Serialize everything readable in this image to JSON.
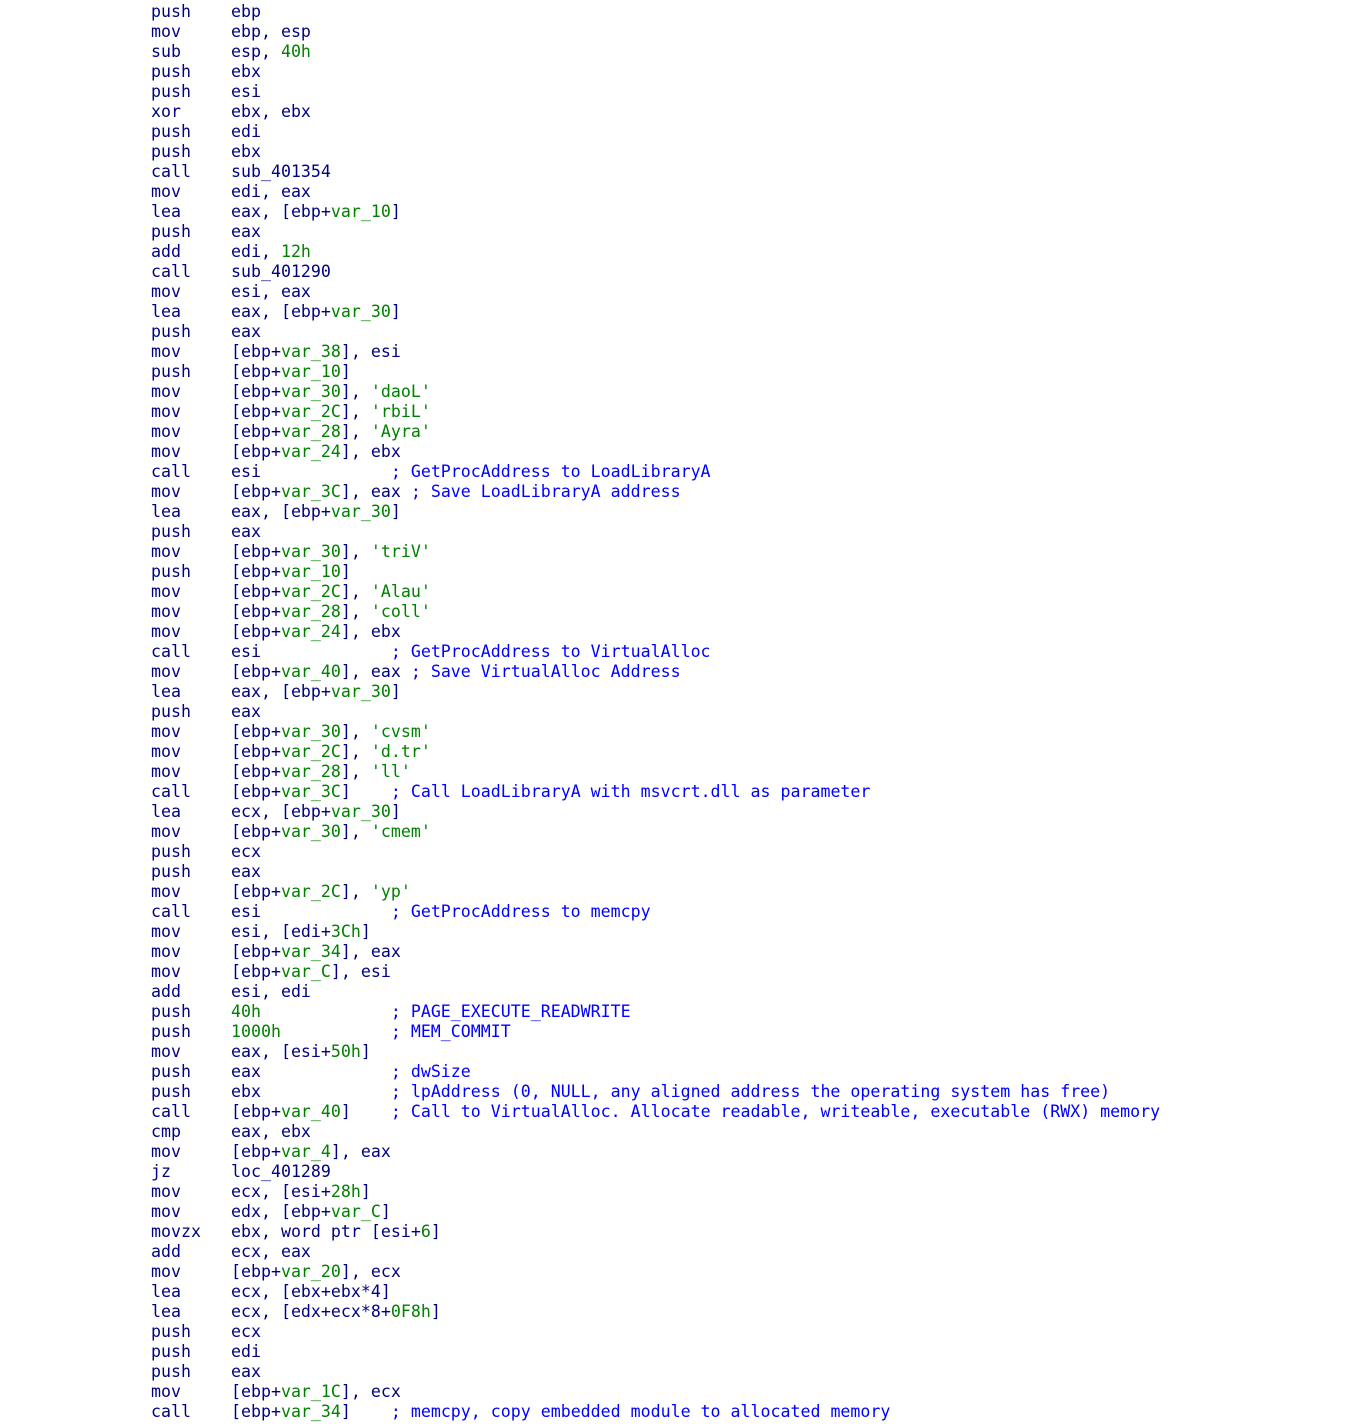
{
  "colors": {
    "background": "#ffffff",
    "instruction": "#000080",
    "variable": "#008000",
    "immediate": "#008000",
    "string": "#008000",
    "comment": "#0000ff"
  },
  "lines": [
    {
      "mnem": "push",
      "ops": [
        [
          "n",
          "ebp"
        ]
      ],
      "pad": "",
      "comment": ""
    },
    {
      "mnem": "mov",
      "ops": [
        [
          "n",
          "ebp, esp"
        ]
      ],
      "pad": "",
      "comment": ""
    },
    {
      "mnem": "sub",
      "ops": [
        [
          "n",
          "esp, "
        ],
        [
          "h",
          "40h"
        ]
      ],
      "pad": "",
      "comment": ""
    },
    {
      "mnem": "push",
      "ops": [
        [
          "n",
          "ebx"
        ]
      ],
      "pad": "",
      "comment": ""
    },
    {
      "mnem": "push",
      "ops": [
        [
          "n",
          "esi"
        ]
      ],
      "pad": "",
      "comment": ""
    },
    {
      "mnem": "xor",
      "ops": [
        [
          "n",
          "ebx, ebx"
        ]
      ],
      "pad": "",
      "comment": ""
    },
    {
      "mnem": "push",
      "ops": [
        [
          "n",
          "edi"
        ]
      ],
      "pad": "",
      "comment": ""
    },
    {
      "mnem": "push",
      "ops": [
        [
          "n",
          "ebx"
        ]
      ],
      "pad": "",
      "comment": ""
    },
    {
      "mnem": "call",
      "ops": [
        [
          "n",
          "sub_401354"
        ]
      ],
      "pad": "",
      "comment": ""
    },
    {
      "mnem": "mov",
      "ops": [
        [
          "n",
          "edi, eax"
        ]
      ],
      "pad": "",
      "comment": ""
    },
    {
      "mnem": "lea",
      "ops": [
        [
          "n",
          "eax, [ebp+"
        ],
        [
          "v",
          "var_10"
        ],
        [
          "n",
          "]"
        ]
      ],
      "pad": "",
      "comment": ""
    },
    {
      "mnem": "push",
      "ops": [
        [
          "n",
          "eax"
        ]
      ],
      "pad": "",
      "comment": ""
    },
    {
      "mnem": "add",
      "ops": [
        [
          "n",
          "edi, "
        ],
        [
          "h",
          "12h"
        ]
      ],
      "pad": "",
      "comment": ""
    },
    {
      "mnem": "call",
      "ops": [
        [
          "n",
          "sub_401290"
        ]
      ],
      "pad": "",
      "comment": ""
    },
    {
      "mnem": "mov",
      "ops": [
        [
          "n",
          "esi, eax"
        ]
      ],
      "pad": "",
      "comment": ""
    },
    {
      "mnem": "lea",
      "ops": [
        [
          "n",
          "eax, [ebp+"
        ],
        [
          "v",
          "var_30"
        ],
        [
          "n",
          "]"
        ]
      ],
      "pad": "",
      "comment": ""
    },
    {
      "mnem": "push",
      "ops": [
        [
          "n",
          "eax"
        ]
      ],
      "pad": "",
      "comment": ""
    },
    {
      "mnem": "mov",
      "ops": [
        [
          "n",
          "[ebp+"
        ],
        [
          "v",
          "var_38"
        ],
        [
          "n",
          "], esi"
        ]
      ],
      "pad": "",
      "comment": ""
    },
    {
      "mnem": "push",
      "ops": [
        [
          "n",
          "[ebp+"
        ],
        [
          "v",
          "var_10"
        ],
        [
          "n",
          "]"
        ]
      ],
      "pad": "",
      "comment": ""
    },
    {
      "mnem": "mov",
      "ops": [
        [
          "n",
          "[ebp+"
        ],
        [
          "v",
          "var_30"
        ],
        [
          "n",
          "], "
        ],
        [
          "s",
          "'daoL'"
        ]
      ],
      "pad": "",
      "comment": ""
    },
    {
      "mnem": "mov",
      "ops": [
        [
          "n",
          "[ebp+"
        ],
        [
          "v",
          "var_2C"
        ],
        [
          "n",
          "], "
        ],
        [
          "s",
          "'rbiL'"
        ]
      ],
      "pad": "",
      "comment": ""
    },
    {
      "mnem": "mov",
      "ops": [
        [
          "n",
          "[ebp+"
        ],
        [
          "v",
          "var_28"
        ],
        [
          "n",
          "], "
        ],
        [
          "s",
          "'Ayra'"
        ]
      ],
      "pad": "",
      "comment": ""
    },
    {
      "mnem": "mov",
      "ops": [
        [
          "n",
          "[ebp+"
        ],
        [
          "v",
          "var_24"
        ],
        [
          "n",
          "], ebx"
        ]
      ],
      "pad": "",
      "comment": ""
    },
    {
      "mnem": "call",
      "ops": [
        [
          "n",
          "esi"
        ]
      ],
      "pad": "             ",
      "comment": "; GetProcAddress to LoadLibraryA"
    },
    {
      "mnem": "mov",
      "ops": [
        [
          "n",
          "[ebp+"
        ],
        [
          "v",
          "var_3C"
        ],
        [
          "n",
          "], eax"
        ]
      ],
      "pad": " ",
      "comment": "; Save LoadLibraryA address"
    },
    {
      "mnem": "lea",
      "ops": [
        [
          "n",
          "eax, [ebp+"
        ],
        [
          "v",
          "var_30"
        ],
        [
          "n",
          "]"
        ]
      ],
      "pad": "",
      "comment": ""
    },
    {
      "mnem": "push",
      "ops": [
        [
          "n",
          "eax"
        ]
      ],
      "pad": "",
      "comment": ""
    },
    {
      "mnem": "mov",
      "ops": [
        [
          "n",
          "[ebp+"
        ],
        [
          "v",
          "var_30"
        ],
        [
          "n",
          "], "
        ],
        [
          "s",
          "'triV'"
        ]
      ],
      "pad": "",
      "comment": ""
    },
    {
      "mnem": "push",
      "ops": [
        [
          "n",
          "[ebp+"
        ],
        [
          "v",
          "var_10"
        ],
        [
          "n",
          "]"
        ]
      ],
      "pad": "",
      "comment": ""
    },
    {
      "mnem": "mov",
      "ops": [
        [
          "n",
          "[ebp+"
        ],
        [
          "v",
          "var_2C"
        ],
        [
          "n",
          "], "
        ],
        [
          "s",
          "'Alau'"
        ]
      ],
      "pad": "",
      "comment": ""
    },
    {
      "mnem": "mov",
      "ops": [
        [
          "n",
          "[ebp+"
        ],
        [
          "v",
          "var_28"
        ],
        [
          "n",
          "], "
        ],
        [
          "s",
          "'coll'"
        ]
      ],
      "pad": "",
      "comment": ""
    },
    {
      "mnem": "mov",
      "ops": [
        [
          "n",
          "[ebp+"
        ],
        [
          "v",
          "var_24"
        ],
        [
          "n",
          "], ebx"
        ]
      ],
      "pad": "",
      "comment": ""
    },
    {
      "mnem": "call",
      "ops": [
        [
          "n",
          "esi"
        ]
      ],
      "pad": "             ",
      "comment": "; GetProcAddress to VirtualAlloc"
    },
    {
      "mnem": "mov",
      "ops": [
        [
          "n",
          "[ebp+"
        ],
        [
          "v",
          "var_40"
        ],
        [
          "n",
          "], eax"
        ]
      ],
      "pad": " ",
      "comment": "; Save VirtualAlloc Address"
    },
    {
      "mnem": "lea",
      "ops": [
        [
          "n",
          "eax, [ebp+"
        ],
        [
          "v",
          "var_30"
        ],
        [
          "n",
          "]"
        ]
      ],
      "pad": "",
      "comment": ""
    },
    {
      "mnem": "push",
      "ops": [
        [
          "n",
          "eax"
        ]
      ],
      "pad": "",
      "comment": ""
    },
    {
      "mnem": "mov",
      "ops": [
        [
          "n",
          "[ebp+"
        ],
        [
          "v",
          "var_30"
        ],
        [
          "n",
          "], "
        ],
        [
          "s",
          "'cvsm'"
        ]
      ],
      "pad": "",
      "comment": ""
    },
    {
      "mnem": "mov",
      "ops": [
        [
          "n",
          "[ebp+"
        ],
        [
          "v",
          "var_2C"
        ],
        [
          "n",
          "], "
        ],
        [
          "s",
          "'d.tr'"
        ]
      ],
      "pad": "",
      "comment": ""
    },
    {
      "mnem": "mov",
      "ops": [
        [
          "n",
          "[ebp+"
        ],
        [
          "v",
          "var_28"
        ],
        [
          "n",
          "], "
        ],
        [
          "s",
          "'ll'"
        ]
      ],
      "pad": "",
      "comment": ""
    },
    {
      "mnem": "call",
      "ops": [
        [
          "n",
          "[ebp+"
        ],
        [
          "v",
          "var_3C"
        ],
        [
          "n",
          "]"
        ]
      ],
      "pad": "    ",
      "comment": "; Call LoadLibraryA with msvcrt.dll as parameter"
    },
    {
      "mnem": "lea",
      "ops": [
        [
          "n",
          "ecx, [ebp+"
        ],
        [
          "v",
          "var_30"
        ],
        [
          "n",
          "]"
        ]
      ],
      "pad": "",
      "comment": ""
    },
    {
      "mnem": "mov",
      "ops": [
        [
          "n",
          "[ebp+"
        ],
        [
          "v",
          "var_30"
        ],
        [
          "n",
          "], "
        ],
        [
          "s",
          "'cmem'"
        ]
      ],
      "pad": "",
      "comment": ""
    },
    {
      "mnem": "push",
      "ops": [
        [
          "n",
          "ecx"
        ]
      ],
      "pad": "",
      "comment": ""
    },
    {
      "mnem": "push",
      "ops": [
        [
          "n",
          "eax"
        ]
      ],
      "pad": "",
      "comment": ""
    },
    {
      "mnem": "mov",
      "ops": [
        [
          "n",
          "[ebp+"
        ],
        [
          "v",
          "var_2C"
        ],
        [
          "n",
          "], "
        ],
        [
          "s",
          "'yp'"
        ]
      ],
      "pad": "",
      "comment": ""
    },
    {
      "mnem": "call",
      "ops": [
        [
          "n",
          "esi"
        ]
      ],
      "pad": "             ",
      "comment": "; GetProcAddress to memcpy"
    },
    {
      "mnem": "mov",
      "ops": [
        [
          "n",
          "esi, [edi+"
        ],
        [
          "h",
          "3Ch"
        ],
        [
          "n",
          "]"
        ]
      ],
      "pad": "",
      "comment": ""
    },
    {
      "mnem": "mov",
      "ops": [
        [
          "n",
          "[ebp+"
        ],
        [
          "v",
          "var_34"
        ],
        [
          "n",
          "], eax"
        ]
      ],
      "pad": "",
      "comment": ""
    },
    {
      "mnem": "mov",
      "ops": [
        [
          "n",
          "[ebp+"
        ],
        [
          "v",
          "var_C"
        ],
        [
          "n",
          "], esi"
        ]
      ],
      "pad": "",
      "comment": ""
    },
    {
      "mnem": "add",
      "ops": [
        [
          "n",
          "esi, edi"
        ]
      ],
      "pad": "",
      "comment": ""
    },
    {
      "mnem": "push",
      "ops": [
        [
          "h",
          "40h"
        ]
      ],
      "pad": "             ",
      "comment": "; PAGE_EXECUTE_READWRITE"
    },
    {
      "mnem": "push",
      "ops": [
        [
          "h",
          "1000h"
        ]
      ],
      "pad": "           ",
      "comment": "; MEM_COMMIT"
    },
    {
      "mnem": "mov",
      "ops": [
        [
          "n",
          "eax, [esi+"
        ],
        [
          "h",
          "50h"
        ],
        [
          "n",
          "]"
        ]
      ],
      "pad": "",
      "comment": ""
    },
    {
      "mnem": "push",
      "ops": [
        [
          "n",
          "eax"
        ]
      ],
      "pad": "             ",
      "comment": "; dwSize"
    },
    {
      "mnem": "push",
      "ops": [
        [
          "n",
          "ebx"
        ]
      ],
      "pad": "             ",
      "comment": "; lpAddress (0, NULL, any aligned address the operating system has free)"
    },
    {
      "mnem": "call",
      "ops": [
        [
          "n",
          "[ebp+"
        ],
        [
          "v",
          "var_40"
        ],
        [
          "n",
          "]"
        ]
      ],
      "pad": "    ",
      "comment": "; Call to VirtualAlloc. Allocate readable, writeable, executable (RWX) memory"
    },
    {
      "mnem": "cmp",
      "ops": [
        [
          "n",
          "eax, ebx"
        ]
      ],
      "pad": "",
      "comment": ""
    },
    {
      "mnem": "mov",
      "ops": [
        [
          "n",
          "[ebp+"
        ],
        [
          "v",
          "var_4"
        ],
        [
          "n",
          "], eax"
        ]
      ],
      "pad": "",
      "comment": ""
    },
    {
      "mnem": "jz",
      "ops": [
        [
          "n",
          "loc_401289"
        ]
      ],
      "pad": "",
      "comment": ""
    },
    {
      "mnem": "mov",
      "ops": [
        [
          "n",
          "ecx, [esi+"
        ],
        [
          "h",
          "28h"
        ],
        [
          "n",
          "]"
        ]
      ],
      "pad": "",
      "comment": ""
    },
    {
      "mnem": "mov",
      "ops": [
        [
          "n",
          "edx, [ebp+"
        ],
        [
          "v",
          "var_C"
        ],
        [
          "n",
          "]"
        ]
      ],
      "pad": "",
      "comment": ""
    },
    {
      "mnem": "movzx",
      "ops": [
        [
          "n",
          "ebx, word ptr [esi+"
        ],
        [
          "h",
          "6"
        ],
        [
          "n",
          "]"
        ]
      ],
      "pad": "",
      "comment": ""
    },
    {
      "mnem": "add",
      "ops": [
        [
          "n",
          "ecx, eax"
        ]
      ],
      "pad": "",
      "comment": ""
    },
    {
      "mnem": "mov",
      "ops": [
        [
          "n",
          "[ebp+"
        ],
        [
          "v",
          "var_20"
        ],
        [
          "n",
          "], ecx"
        ]
      ],
      "pad": "",
      "comment": ""
    },
    {
      "mnem": "lea",
      "ops": [
        [
          "n",
          "ecx, [ebx+ebx*4]"
        ]
      ],
      "pad": "",
      "comment": ""
    },
    {
      "mnem": "lea",
      "ops": [
        [
          "n",
          "ecx, [edx+ecx*8+"
        ],
        [
          "h",
          "0F8h"
        ],
        [
          "n",
          "]"
        ]
      ],
      "pad": "",
      "comment": ""
    },
    {
      "mnem": "push",
      "ops": [
        [
          "n",
          "ecx"
        ]
      ],
      "pad": "",
      "comment": ""
    },
    {
      "mnem": "push",
      "ops": [
        [
          "n",
          "edi"
        ]
      ],
      "pad": "",
      "comment": ""
    },
    {
      "mnem": "push",
      "ops": [
        [
          "n",
          "eax"
        ]
      ],
      "pad": "",
      "comment": ""
    },
    {
      "mnem": "mov",
      "ops": [
        [
          "n",
          "[ebp+"
        ],
        [
          "v",
          "var_1C"
        ],
        [
          "n",
          "], ecx"
        ]
      ],
      "pad": "",
      "comment": ""
    },
    {
      "mnem": "call",
      "ops": [
        [
          "n",
          "[ebp+"
        ],
        [
          "v",
          "var_34"
        ],
        [
          "n",
          "]"
        ]
      ],
      "pad": "    ",
      "comment": "; memcpy, copy embedded module to allocated memory"
    }
  ]
}
